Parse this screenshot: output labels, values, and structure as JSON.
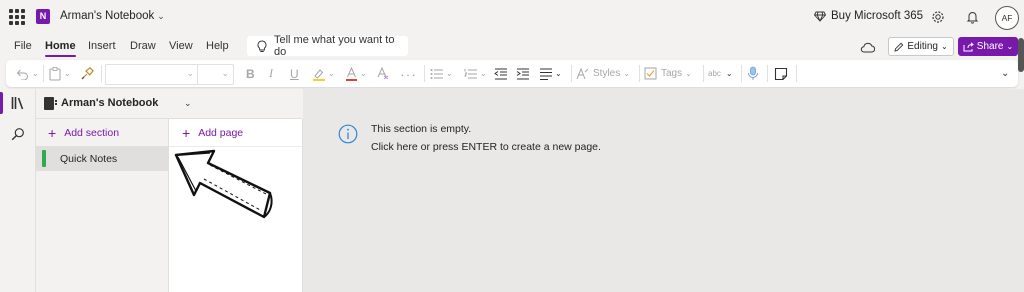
{
  "app": {
    "notebook_title": "Arman's Notebook",
    "buy_label": "Buy Microsoft 365",
    "avatar_initials": "AF",
    "brand_color": "#7719aa"
  },
  "menu": {
    "items": [
      {
        "label": "File"
      },
      {
        "label": "Home",
        "active": true
      },
      {
        "label": "Insert"
      },
      {
        "label": "Draw"
      },
      {
        "label": "View"
      },
      {
        "label": "Help"
      }
    ],
    "tell_me_placeholder": "Tell me what you want to do",
    "editing_label": "Editing",
    "share_label": "Share"
  },
  "ribbon": {
    "styles_label": "Styles",
    "tags_label": "Tags",
    "spelling_label": "abc",
    "bold": "B",
    "italic": "I",
    "underline": "U"
  },
  "navigation": {
    "notebook_name": "Arman's Notebook",
    "add_section_label": "Add section",
    "add_page_label": "Add page",
    "sections": [
      {
        "label": "Quick Notes",
        "color": "#33a853",
        "selected": true
      }
    ]
  },
  "canvas": {
    "empty_title": "This section is empty.",
    "empty_hint": "Click here or press ENTER to create a new page."
  },
  "icons": {
    "app_launcher": "waffle-icon",
    "app_logo": "onenote-logo-icon",
    "logo_letter": "N",
    "premium": "diamond-icon",
    "settings": "gear-icon",
    "notifications": "bell-icon",
    "tell_me": "lightbulb-icon",
    "sync": "cloud-icon",
    "notebooks": "library-icon",
    "search": "search-icon",
    "info": "info-icon",
    "annotation": "hand-drawn-arrow"
  }
}
